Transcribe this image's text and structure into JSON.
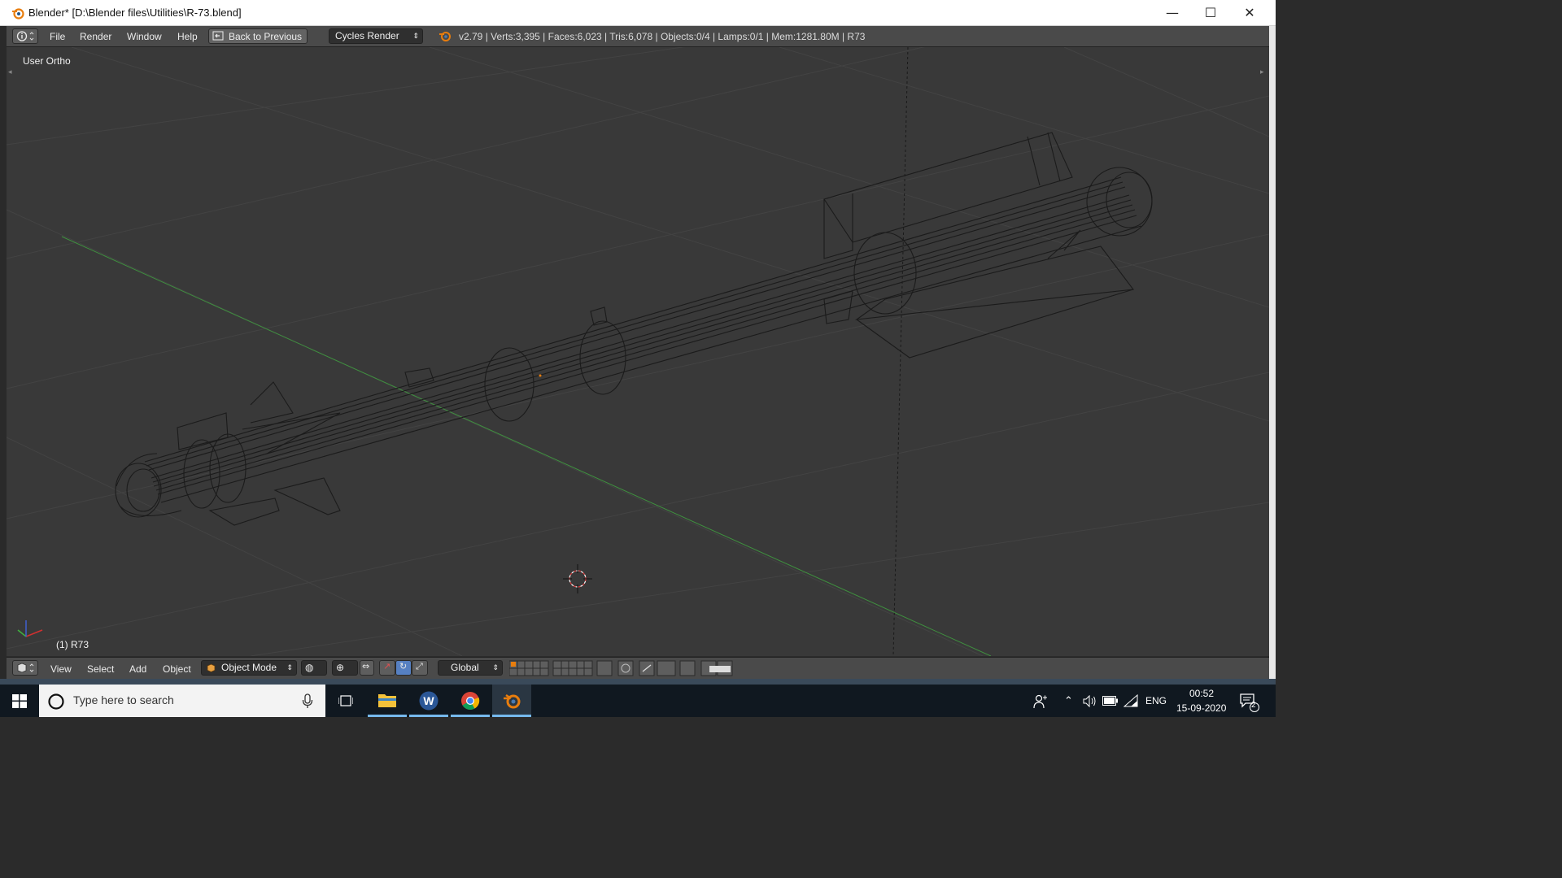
{
  "window": {
    "title": "Blender* [D:\\Blender files\\Utilities\\R-73.blend]",
    "controls": {
      "minimize": "—",
      "maximize": "☐",
      "close": "✕"
    }
  },
  "info_header": {
    "menus": [
      "File",
      "Render",
      "Window",
      "Help"
    ],
    "back_button": "Back to Previous",
    "render_engine": "Cycles Render",
    "stats": "v2.79 | Verts:3,395 | Faces:6,023 | Tris:6,078 | Objects:0/4 | Lamps:0/1 | Mem:1281.80M | R73"
  },
  "viewport": {
    "view_name": "User Ortho",
    "active_object": "(1) R73"
  },
  "view3d_header": {
    "menus": [
      "View",
      "Select",
      "Add",
      "Object"
    ],
    "mode": "Object Mode",
    "orientation": "Global"
  },
  "taskbar": {
    "search_placeholder": "Type here to search",
    "language": "ENG",
    "time": "00:52",
    "date": "15-09-2020",
    "notification_count": "2"
  },
  "colors": {
    "viewport_bg": "#393939",
    "wire": "#1a1a1a",
    "x_axis": "#3f9a3f",
    "header": "#4a4a4a",
    "taskbar": "#101820",
    "accent_orange": "#e87d0d"
  }
}
